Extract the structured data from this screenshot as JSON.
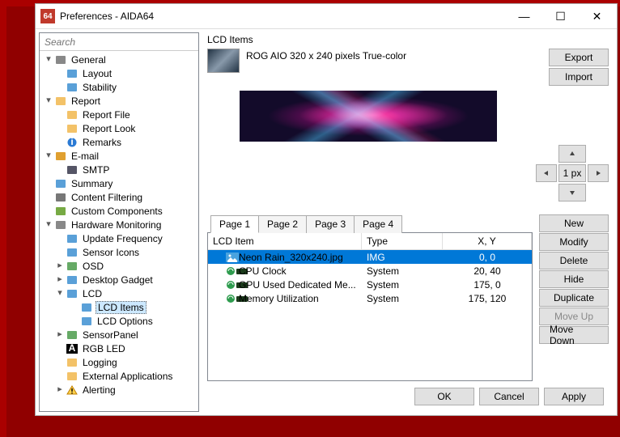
{
  "window": {
    "title": "Preferences - AIDA64",
    "icon_text": "64"
  },
  "search": {
    "placeholder": "Search"
  },
  "tree": [
    {
      "label": "General",
      "depth": 0,
      "twist": "▾",
      "icon": "gear",
      "sel": false
    },
    {
      "label": "Layout",
      "depth": 1,
      "icon": "layout"
    },
    {
      "label": "Stability",
      "depth": 1,
      "icon": "stability"
    },
    {
      "label": "Report",
      "depth": 0,
      "twist": "▾",
      "icon": "folder"
    },
    {
      "label": "Report File",
      "depth": 1,
      "icon": "page"
    },
    {
      "label": "Report Look",
      "depth": 1,
      "icon": "page"
    },
    {
      "label": "Remarks",
      "depth": 1,
      "icon": "info"
    },
    {
      "label": "E-mail",
      "depth": 0,
      "twist": "▾",
      "icon": "mail"
    },
    {
      "label": "SMTP",
      "depth": 1,
      "icon": "smtp"
    },
    {
      "label": "Summary",
      "depth": 0,
      "icon": "summary"
    },
    {
      "label": "Content Filtering",
      "depth": 0,
      "icon": "filter"
    },
    {
      "label": "Custom Components",
      "depth": 0,
      "icon": "custom"
    },
    {
      "label": "Hardware Monitoring",
      "depth": 0,
      "twist": "▾",
      "icon": "hw"
    },
    {
      "label": "Update Frequency",
      "depth": 1,
      "icon": "freq"
    },
    {
      "label": "Sensor Icons",
      "depth": 1,
      "icon": "sensor"
    },
    {
      "label": "OSD",
      "depth": 1,
      "twist": "▸",
      "icon": "osd"
    },
    {
      "label": "Desktop Gadget",
      "depth": 1,
      "twist": "▸",
      "icon": "gadget"
    },
    {
      "label": "LCD",
      "depth": 1,
      "twist": "▾",
      "icon": "lcd"
    },
    {
      "label": "LCD Items",
      "depth": 2,
      "icon": "lcditems",
      "sel": true
    },
    {
      "label": "LCD Options",
      "depth": 2,
      "icon": "lcdopt"
    },
    {
      "label": "SensorPanel",
      "depth": 1,
      "twist": "▸",
      "icon": "spanel"
    },
    {
      "label": "RGB LED",
      "depth": 1,
      "icon": "rgb"
    },
    {
      "label": "Logging",
      "depth": 1,
      "icon": "log"
    },
    {
      "label": "External Applications",
      "depth": 1,
      "icon": "ext"
    },
    {
      "label": "Alerting",
      "depth": 1,
      "twist": "▸",
      "icon": "alert"
    }
  ],
  "lcd": {
    "section": "LCD Items",
    "desc": "ROG AIO 320 x 240 pixels True-color",
    "export": "Export",
    "import": "Import",
    "nudge_center": "1 px",
    "tabs": [
      "Page 1",
      "Page 2",
      "Page 3",
      "Page 4"
    ],
    "active_tab": 0,
    "headers": {
      "item": "LCD Item",
      "type": "Type",
      "xy": "X, Y"
    },
    "rows": [
      {
        "name": "Neon Rain_320x240.jpg",
        "type": "IMG",
        "xy": "0, 0",
        "icon": "img",
        "sel": true
      },
      {
        "name": "CPU Clock",
        "type": "System",
        "xy": "20, 40",
        "icon": "sys"
      },
      {
        "name": "GPU Used Dedicated Me...",
        "type": "System",
        "xy": "175, 0",
        "icon": "sys"
      },
      {
        "name": "Memory Utilization",
        "type": "System",
        "xy": "175, 120",
        "icon": "sys"
      }
    ],
    "buttons": {
      "new": "New",
      "modify": "Modify",
      "delete": "Delete",
      "hide": "Hide",
      "duplicate": "Duplicate",
      "moveup": "Move Up",
      "movedown": "Move Down"
    }
  },
  "footer": {
    "ok": "OK",
    "cancel": "Cancel",
    "apply": "Apply"
  }
}
